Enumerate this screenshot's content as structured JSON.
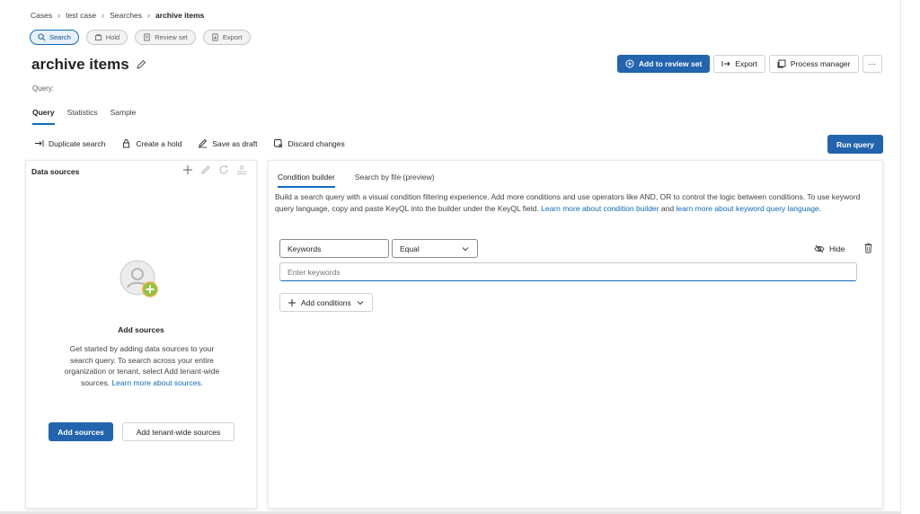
{
  "breadcrumb": [
    "Cases",
    "test case",
    "Searches",
    "archive items"
  ],
  "pills": [
    {
      "label": "Search",
      "icon": "search-icon",
      "active": true
    },
    {
      "label": "Hold",
      "icon": "hold-icon",
      "active": false
    },
    {
      "label": "Review set",
      "icon": "review-set-icon",
      "active": false
    },
    {
      "label": "Export",
      "icon": "export-icon",
      "active": false
    }
  ],
  "page": {
    "title": "archive items",
    "query_label": "Query:"
  },
  "header_actions": {
    "add_review": "Add to review set",
    "export": "Export",
    "process_manager": "Process manager",
    "more": "···"
  },
  "tabs": [
    {
      "label": "Query",
      "active": true
    },
    {
      "label": "Statistics",
      "active": false
    },
    {
      "label": "Sample",
      "active": false
    }
  ],
  "toolbar": {
    "duplicate": "Duplicate search",
    "create_hold": "Create a hold",
    "save_draft": "Save as draft",
    "discard": "Discard changes",
    "run": "Run query"
  },
  "data_sources": {
    "header": "Data sources",
    "empty_title": "Add sources",
    "empty_desc": "Get started by adding data sources to your search query. To search across your entire organization or tenant, select Add tenant-wide sources.",
    "learn_more": "Learn more about sources.",
    "add_sources": "Add sources",
    "add_tenant": "Add tenant-wide sources"
  },
  "builder": {
    "tab_condition": "Condition builder",
    "tab_file": "Search by file (preview)",
    "desc": "Build a search query with a visual condition filtering experience. Add more conditions and use operators like AND, OR to control the logic between conditions. To use keyword query language, copy and paste KeyQL into the builder under the KeyQL field. ",
    "link1": "Learn more about condition builder",
    "and_text": " and ",
    "link2": "learn more about keyword query language",
    "period": ".",
    "field_name": "Keywords",
    "operator": "Equal",
    "hide": "Hide",
    "keyword_placeholder": "Enter keywords",
    "add_conditions": "Add conditions"
  },
  "colors": {
    "accent": "#2264ae",
    "link": "#0f6cbd"
  }
}
